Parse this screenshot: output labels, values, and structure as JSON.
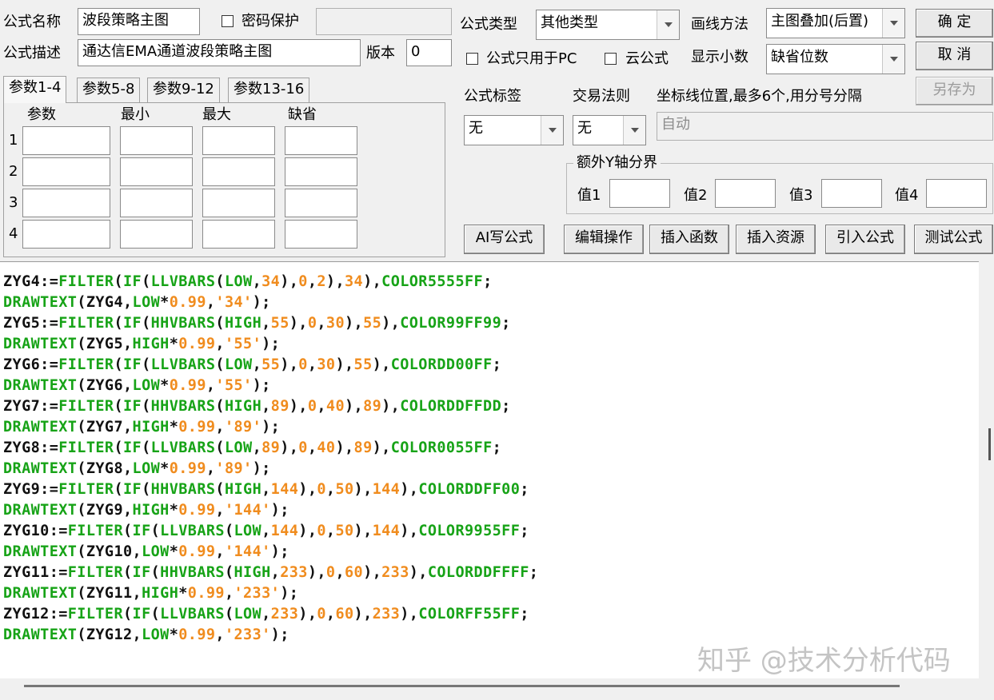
{
  "form": {
    "name_label": "公式名称",
    "name_value": "波段策略主图",
    "password_label": "密码保护",
    "password_value": "",
    "desc_label": "公式描述",
    "desc_value": "通达信EMA通道波段策略主图",
    "version_label": "版本",
    "version_value": "0"
  },
  "tabs": [
    "参数1-4",
    "参数5-8",
    "参数9-12",
    "参数13-16"
  ],
  "params": {
    "headers": [
      "参数",
      "最小",
      "最大",
      "缺省"
    ],
    "rows": [
      "1",
      "2",
      "3",
      "4"
    ]
  },
  "right": {
    "type_label": "公式类型",
    "type_value": "其他类型",
    "draw_label": "画线方法",
    "draw_value": "主图叠加(后置)",
    "pc_only_label": "公式只用于PC",
    "cloud_label": "云公式",
    "decimals_label": "显示小数",
    "decimals_value": "缺省位数",
    "tag_label": "公式标签",
    "tag_value": "无",
    "rule_label": "交易法则",
    "rule_value": "无",
    "coord_label": "坐标线位置,最多6个,用分号分隔",
    "coord_value": "自动",
    "yaxis_title": "额外Y轴分界",
    "yaxis_values": [
      "值1",
      "值2",
      "值3",
      "值4"
    ]
  },
  "buttons": {
    "ok": "确 定",
    "cancel": "取 消",
    "save_as": "另存为",
    "ai": "AI写公式",
    "edit": "编辑操作",
    "insert_func": "插入函数",
    "insert_res": "插入资源",
    "import": "引入公式",
    "test": "测试公式"
  },
  "code_lines": [
    [
      [
        "v",
        "ZYG4:="
      ],
      [
        "f",
        "FILTER"
      ],
      [
        "v",
        "("
      ],
      [
        "f",
        "IF"
      ],
      [
        "v",
        "("
      ],
      [
        "f",
        "LLVBARS"
      ],
      [
        "v",
        "("
      ],
      [
        "f",
        "LOW"
      ],
      [
        "v",
        ","
      ],
      [
        "n",
        "34"
      ],
      [
        "v",
        "),"
      ],
      [
        "n",
        "0"
      ],
      [
        "v",
        ","
      ],
      [
        "n",
        "2"
      ],
      [
        "v",
        "),"
      ],
      [
        "n",
        "34"
      ],
      [
        "v",
        "),"
      ],
      [
        "c",
        "COLOR5555FF"
      ],
      [
        "v",
        ";"
      ]
    ],
    [
      [
        "f",
        "DRAWTEXT"
      ],
      [
        "v",
        "(ZYG4,"
      ],
      [
        "f",
        "LOW"
      ],
      [
        "v",
        "*"
      ],
      [
        "n",
        "0.99"
      ],
      [
        "v",
        ","
      ],
      [
        "n",
        "'34'"
      ],
      [
        "v",
        ");"
      ]
    ],
    [
      [
        "v",
        "ZYG5:="
      ],
      [
        "f",
        "FILTER"
      ],
      [
        "v",
        "("
      ],
      [
        "f",
        "IF"
      ],
      [
        "v",
        "("
      ],
      [
        "f",
        "HHVBARS"
      ],
      [
        "v",
        "("
      ],
      [
        "f",
        "HIGH"
      ],
      [
        "v",
        ","
      ],
      [
        "n",
        "55"
      ],
      [
        "v",
        "),"
      ],
      [
        "n",
        "0"
      ],
      [
        "v",
        ","
      ],
      [
        "n",
        "30"
      ],
      [
        "v",
        "),"
      ],
      [
        "n",
        "55"
      ],
      [
        "v",
        "),"
      ],
      [
        "c",
        "COLOR99FF99"
      ],
      [
        "v",
        ";"
      ]
    ],
    [
      [
        "f",
        "DRAWTEXT"
      ],
      [
        "v",
        "(ZYG5,"
      ],
      [
        "f",
        "HIGH"
      ],
      [
        "v",
        "*"
      ],
      [
        "n",
        "0.99"
      ],
      [
        "v",
        ","
      ],
      [
        "n",
        "'55'"
      ],
      [
        "v",
        ");"
      ]
    ],
    [
      [
        "v",
        "ZYG6:="
      ],
      [
        "f",
        "FILTER"
      ],
      [
        "v",
        "("
      ],
      [
        "f",
        "IF"
      ],
      [
        "v",
        "("
      ],
      [
        "f",
        "LLVBARS"
      ],
      [
        "v",
        "("
      ],
      [
        "f",
        "LOW"
      ],
      [
        "v",
        ","
      ],
      [
        "n",
        "55"
      ],
      [
        "v",
        "),"
      ],
      [
        "n",
        "0"
      ],
      [
        "v",
        ","
      ],
      [
        "n",
        "30"
      ],
      [
        "v",
        "),"
      ],
      [
        "n",
        "55"
      ],
      [
        "v",
        "),"
      ],
      [
        "c",
        "COLORDD00FF"
      ],
      [
        "v",
        ";"
      ]
    ],
    [
      [
        "f",
        "DRAWTEXT"
      ],
      [
        "v",
        "(ZYG6,"
      ],
      [
        "f",
        "LOW"
      ],
      [
        "v",
        "*"
      ],
      [
        "n",
        "0.99"
      ],
      [
        "v",
        ","
      ],
      [
        "n",
        "'55'"
      ],
      [
        "v",
        ");"
      ]
    ],
    [
      [
        "v",
        "ZYG7:="
      ],
      [
        "f",
        "FILTER"
      ],
      [
        "v",
        "("
      ],
      [
        "f",
        "IF"
      ],
      [
        "v",
        "("
      ],
      [
        "f",
        "HHVBARS"
      ],
      [
        "v",
        "("
      ],
      [
        "f",
        "HIGH"
      ],
      [
        "v",
        ","
      ],
      [
        "n",
        "89"
      ],
      [
        "v",
        "),"
      ],
      [
        "n",
        "0"
      ],
      [
        "v",
        ","
      ],
      [
        "n",
        "40"
      ],
      [
        "v",
        "),"
      ],
      [
        "n",
        "89"
      ],
      [
        "v",
        "),"
      ],
      [
        "c",
        "COLORDDFFDD"
      ],
      [
        "v",
        ";"
      ]
    ],
    [
      [
        "f",
        "DRAWTEXT"
      ],
      [
        "v",
        "(ZYG7,"
      ],
      [
        "f",
        "HIGH"
      ],
      [
        "v",
        "*"
      ],
      [
        "n",
        "0.99"
      ],
      [
        "v",
        ","
      ],
      [
        "n",
        "'89'"
      ],
      [
        "v",
        ");"
      ]
    ],
    [
      [
        "v",
        "ZYG8:="
      ],
      [
        "f",
        "FILTER"
      ],
      [
        "v",
        "("
      ],
      [
        "f",
        "IF"
      ],
      [
        "v",
        "("
      ],
      [
        "f",
        "LLVBARS"
      ],
      [
        "v",
        "("
      ],
      [
        "f",
        "LOW"
      ],
      [
        "v",
        ","
      ],
      [
        "n",
        "89"
      ],
      [
        "v",
        "),"
      ],
      [
        "n",
        "0"
      ],
      [
        "v",
        ","
      ],
      [
        "n",
        "40"
      ],
      [
        "v",
        "),"
      ],
      [
        "n",
        "89"
      ],
      [
        "v",
        "),"
      ],
      [
        "c",
        "COLOR0055FF"
      ],
      [
        "v",
        ";"
      ]
    ],
    [
      [
        "f",
        "DRAWTEXT"
      ],
      [
        "v",
        "(ZYG8,"
      ],
      [
        "f",
        "LOW"
      ],
      [
        "v",
        "*"
      ],
      [
        "n",
        "0.99"
      ],
      [
        "v",
        ","
      ],
      [
        "n",
        "'89'"
      ],
      [
        "v",
        ");"
      ]
    ],
    [
      [
        "v",
        "ZYG9:="
      ],
      [
        "f",
        "FILTER"
      ],
      [
        "v",
        "("
      ],
      [
        "f",
        "IF"
      ],
      [
        "v",
        "("
      ],
      [
        "f",
        "HHVBARS"
      ],
      [
        "v",
        "("
      ],
      [
        "f",
        "HIGH"
      ],
      [
        "v",
        ","
      ],
      [
        "n",
        "144"
      ],
      [
        "v",
        "),"
      ],
      [
        "n",
        "0"
      ],
      [
        "v",
        ","
      ],
      [
        "n",
        "50"
      ],
      [
        "v",
        "),"
      ],
      [
        "n",
        "144"
      ],
      [
        "v",
        "),"
      ],
      [
        "c",
        "COLORDDFF00"
      ],
      [
        "v",
        ";"
      ]
    ],
    [
      [
        "f",
        "DRAWTEXT"
      ],
      [
        "v",
        "(ZYG9,"
      ],
      [
        "f",
        "HIGH"
      ],
      [
        "v",
        "*"
      ],
      [
        "n",
        "0.99"
      ],
      [
        "v",
        ","
      ],
      [
        "n",
        "'144'"
      ],
      [
        "v",
        ");"
      ]
    ],
    [
      [
        "v",
        "ZYG10:="
      ],
      [
        "f",
        "FILTER"
      ],
      [
        "v",
        "("
      ],
      [
        "f",
        "IF"
      ],
      [
        "v",
        "("
      ],
      [
        "f",
        "LLVBARS"
      ],
      [
        "v",
        "("
      ],
      [
        "f",
        "LOW"
      ],
      [
        "v",
        ","
      ],
      [
        "n",
        "144"
      ],
      [
        "v",
        "),"
      ],
      [
        "n",
        "0"
      ],
      [
        "v",
        ","
      ],
      [
        "n",
        "50"
      ],
      [
        "v",
        "),"
      ],
      [
        "n",
        "144"
      ],
      [
        "v",
        "),"
      ],
      [
        "c",
        "COLOR9955FF"
      ],
      [
        "v",
        ";"
      ]
    ],
    [
      [
        "f",
        "DRAWTEXT"
      ],
      [
        "v",
        "(ZYG10,"
      ],
      [
        "f",
        "LOW"
      ],
      [
        "v",
        "*"
      ],
      [
        "n",
        "0.99"
      ],
      [
        "v",
        ","
      ],
      [
        "n",
        "'144'"
      ],
      [
        "v",
        ");"
      ]
    ],
    [
      [
        "v",
        "ZYG11:="
      ],
      [
        "f",
        "FILTER"
      ],
      [
        "v",
        "("
      ],
      [
        "f",
        "IF"
      ],
      [
        "v",
        "("
      ],
      [
        "f",
        "HHVBARS"
      ],
      [
        "v",
        "("
      ],
      [
        "f",
        "HIGH"
      ],
      [
        "v",
        ","
      ],
      [
        "n",
        "233"
      ],
      [
        "v",
        "),"
      ],
      [
        "n",
        "0"
      ],
      [
        "v",
        ","
      ],
      [
        "n",
        "60"
      ],
      [
        "v",
        "),"
      ],
      [
        "n",
        "233"
      ],
      [
        "v",
        "),"
      ],
      [
        "c",
        "COLORDDFFFF"
      ],
      [
        "v",
        ";"
      ]
    ],
    [
      [
        "f",
        "DRAWTEXT"
      ],
      [
        "v",
        "(ZYG11,"
      ],
      [
        "f",
        "HIGH"
      ],
      [
        "v",
        "*"
      ],
      [
        "n",
        "0.99"
      ],
      [
        "v",
        ","
      ],
      [
        "n",
        "'233'"
      ],
      [
        "v",
        ");"
      ]
    ],
    [
      [
        "v",
        "ZYG12:="
      ],
      [
        "f",
        "FILTER"
      ],
      [
        "v",
        "("
      ],
      [
        "f",
        "IF"
      ],
      [
        "v",
        "("
      ],
      [
        "f",
        "LLVBARS"
      ],
      [
        "v",
        "("
      ],
      [
        "f",
        "LOW"
      ],
      [
        "v",
        ","
      ],
      [
        "n",
        "233"
      ],
      [
        "v",
        "),"
      ],
      [
        "n",
        "0"
      ],
      [
        "v",
        ","
      ],
      [
        "n",
        "60"
      ],
      [
        "v",
        "),"
      ],
      [
        "n",
        "233"
      ],
      [
        "v",
        "),"
      ],
      [
        "c",
        "COLORFF55FF"
      ],
      [
        "v",
        ";"
      ]
    ],
    [
      [
        "f",
        "DRAWTEXT"
      ],
      [
        "v",
        "(ZYG12,"
      ],
      [
        "f",
        "LOW"
      ],
      [
        "v",
        "*"
      ],
      [
        "n",
        "0.99"
      ],
      [
        "v",
        ","
      ],
      [
        "n",
        "'233'"
      ],
      [
        "v",
        ");"
      ]
    ]
  ],
  "watermark": "知乎 @技术分析代码",
  "colors": {
    "func": "#17a317",
    "number": "#f08c1e",
    "text": "#111111"
  }
}
